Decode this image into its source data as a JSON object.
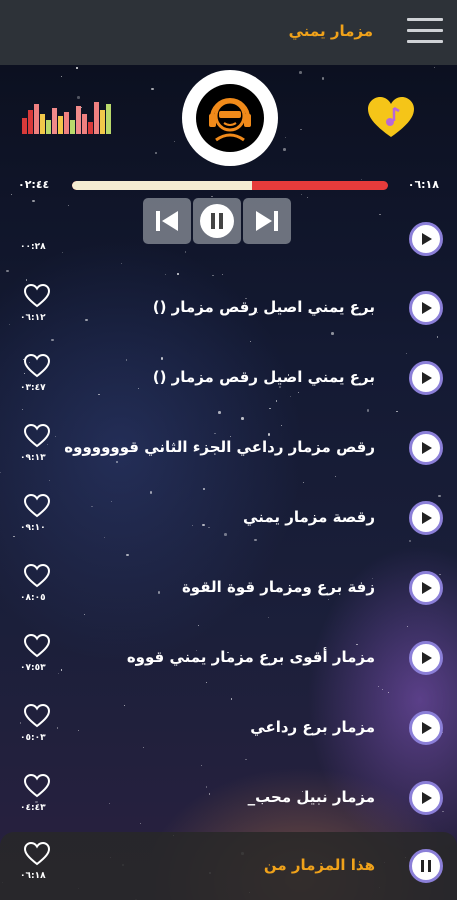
{
  "header": {
    "title": "مزمار يمني"
  },
  "player": {
    "time_elapsed": "٠٢:٤٤",
    "time_total": "٠٦:١٨",
    "progress_fraction": 0.57
  },
  "colors": {
    "accent": "#f0a21a",
    "progress_played": "#f4ecd2",
    "progress_remaining": "#e63b3b",
    "play_ring": "#8b7fd8"
  },
  "songs": [
    {
      "title": "",
      "duration": "٠٠:٢٨"
    },
    {
      "title": "برع يمني اصيل رقص  مزمار ()",
      "duration": "٠٦:١٢"
    },
    {
      "title": "برع يمني اصيل رقص  مزمار ()",
      "duration": "٠٣:٤٧"
    },
    {
      "title": "رقص مزمار رداعي الجزء الثاني قووووووه",
      "duration": "٠٩:١٣"
    },
    {
      "title": "رقصة مزمار يمني",
      "duration": "٠٩:١٠"
    },
    {
      "title": "زفة برع ومزمار قوة القوة",
      "duration": "٠٨:٠٥"
    },
    {
      "title": "مزمار أقوى برع مزمار يمني قووه",
      "duration": "٠٧:٥٣"
    },
    {
      "title": "مزمار برع رداعي",
      "duration": "٠٥:٠٣"
    },
    {
      "title": "مزمار نبيل محب_",
      "duration": "٠٤:٤٣"
    },
    {
      "title": "هذا المزمار من",
      "duration": "٠٦:١٨"
    }
  ],
  "icons": {
    "menu": "hamburger-icon",
    "equalizer": "equalizer-icon",
    "favorite": "heart-music-icon",
    "prev": "skip-previous-icon",
    "pause": "pause-icon",
    "next": "skip-next-icon",
    "like": "heart-outline-icon",
    "play": "play-icon"
  }
}
